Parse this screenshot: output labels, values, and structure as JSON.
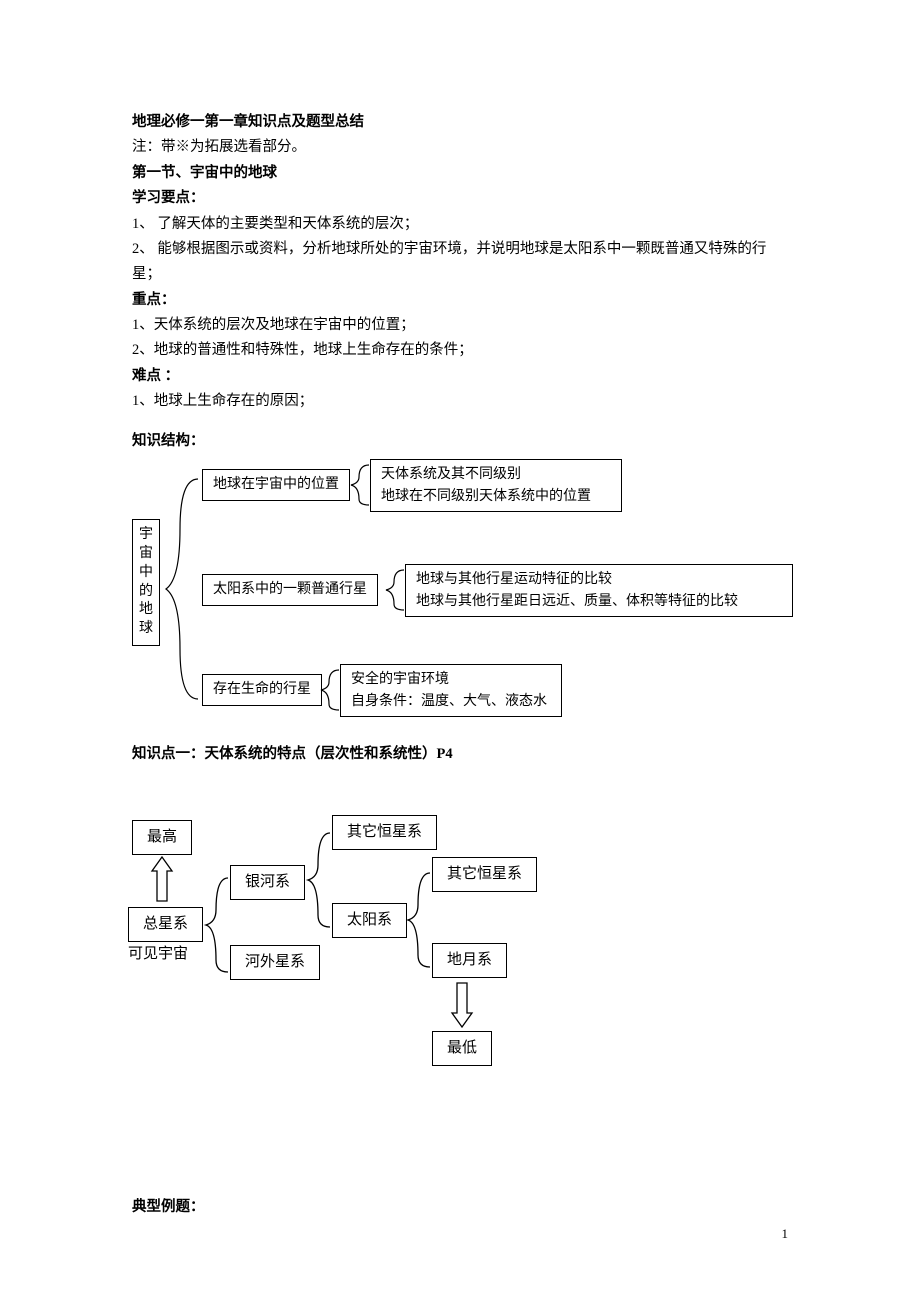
{
  "title": "地理必修一第一章知识点及题型总结",
  "note": "注：带※为拓展选看部分。",
  "sec1_title": "第一节、宇宙中的地球",
  "study_head": "学习要点：",
  "study1": "1、 了解天体的主要类型和天体系统的层次；",
  "study2": "2、 能够根据图示或资料，分析地球所处的宇宙环境，并说明地球是太阳系中一颗既普通又特殊的行星；",
  "focus_head": "重点：",
  "focus1": "1、天体系统的层次及地球在宇宙中的位置；",
  "focus2": "2、地球的普通性和特殊性，地球上生命存在的条件；",
  "diff_head": "难点 ：",
  "diff1": "1、地球上生命存在的原因；",
  "struct_head": "知识结构：",
  "d1": {
    "root_chars": [
      "宇",
      "宙",
      "中",
      "的",
      "地",
      "球"
    ],
    "mid1": "地球在宇宙中的位置",
    "mid2": "太阳系中的一颗普通行星",
    "mid3": "存在生命的行星",
    "r1a": "天体系统及其不同级别",
    "r1b": "地球在不同级别天体系统中的位置",
    "r2a": "地球与其他行星运动特征的比较",
    "r2b": "地球与其他行星距日远近、质量、体积等特征的比较",
    "r3a": "安全的宇宙环境",
    "r3b": "自身条件：温度、大气、液态水"
  },
  "kp1_head": "知识点一：天体系统的特点（层次性和系统性）P4",
  "d2": {
    "highest": "最高",
    "total": "总星系",
    "visible": "可见宇宙",
    "milky": "银河系",
    "extra": "河外星系",
    "otherstar": "其它恒星系",
    "solar": "太阳系",
    "otherstar2": "其它恒星系",
    "earthmoon": "地月系",
    "lowest": "最低"
  },
  "example_head": "典型例题：",
  "page_number": "1"
}
